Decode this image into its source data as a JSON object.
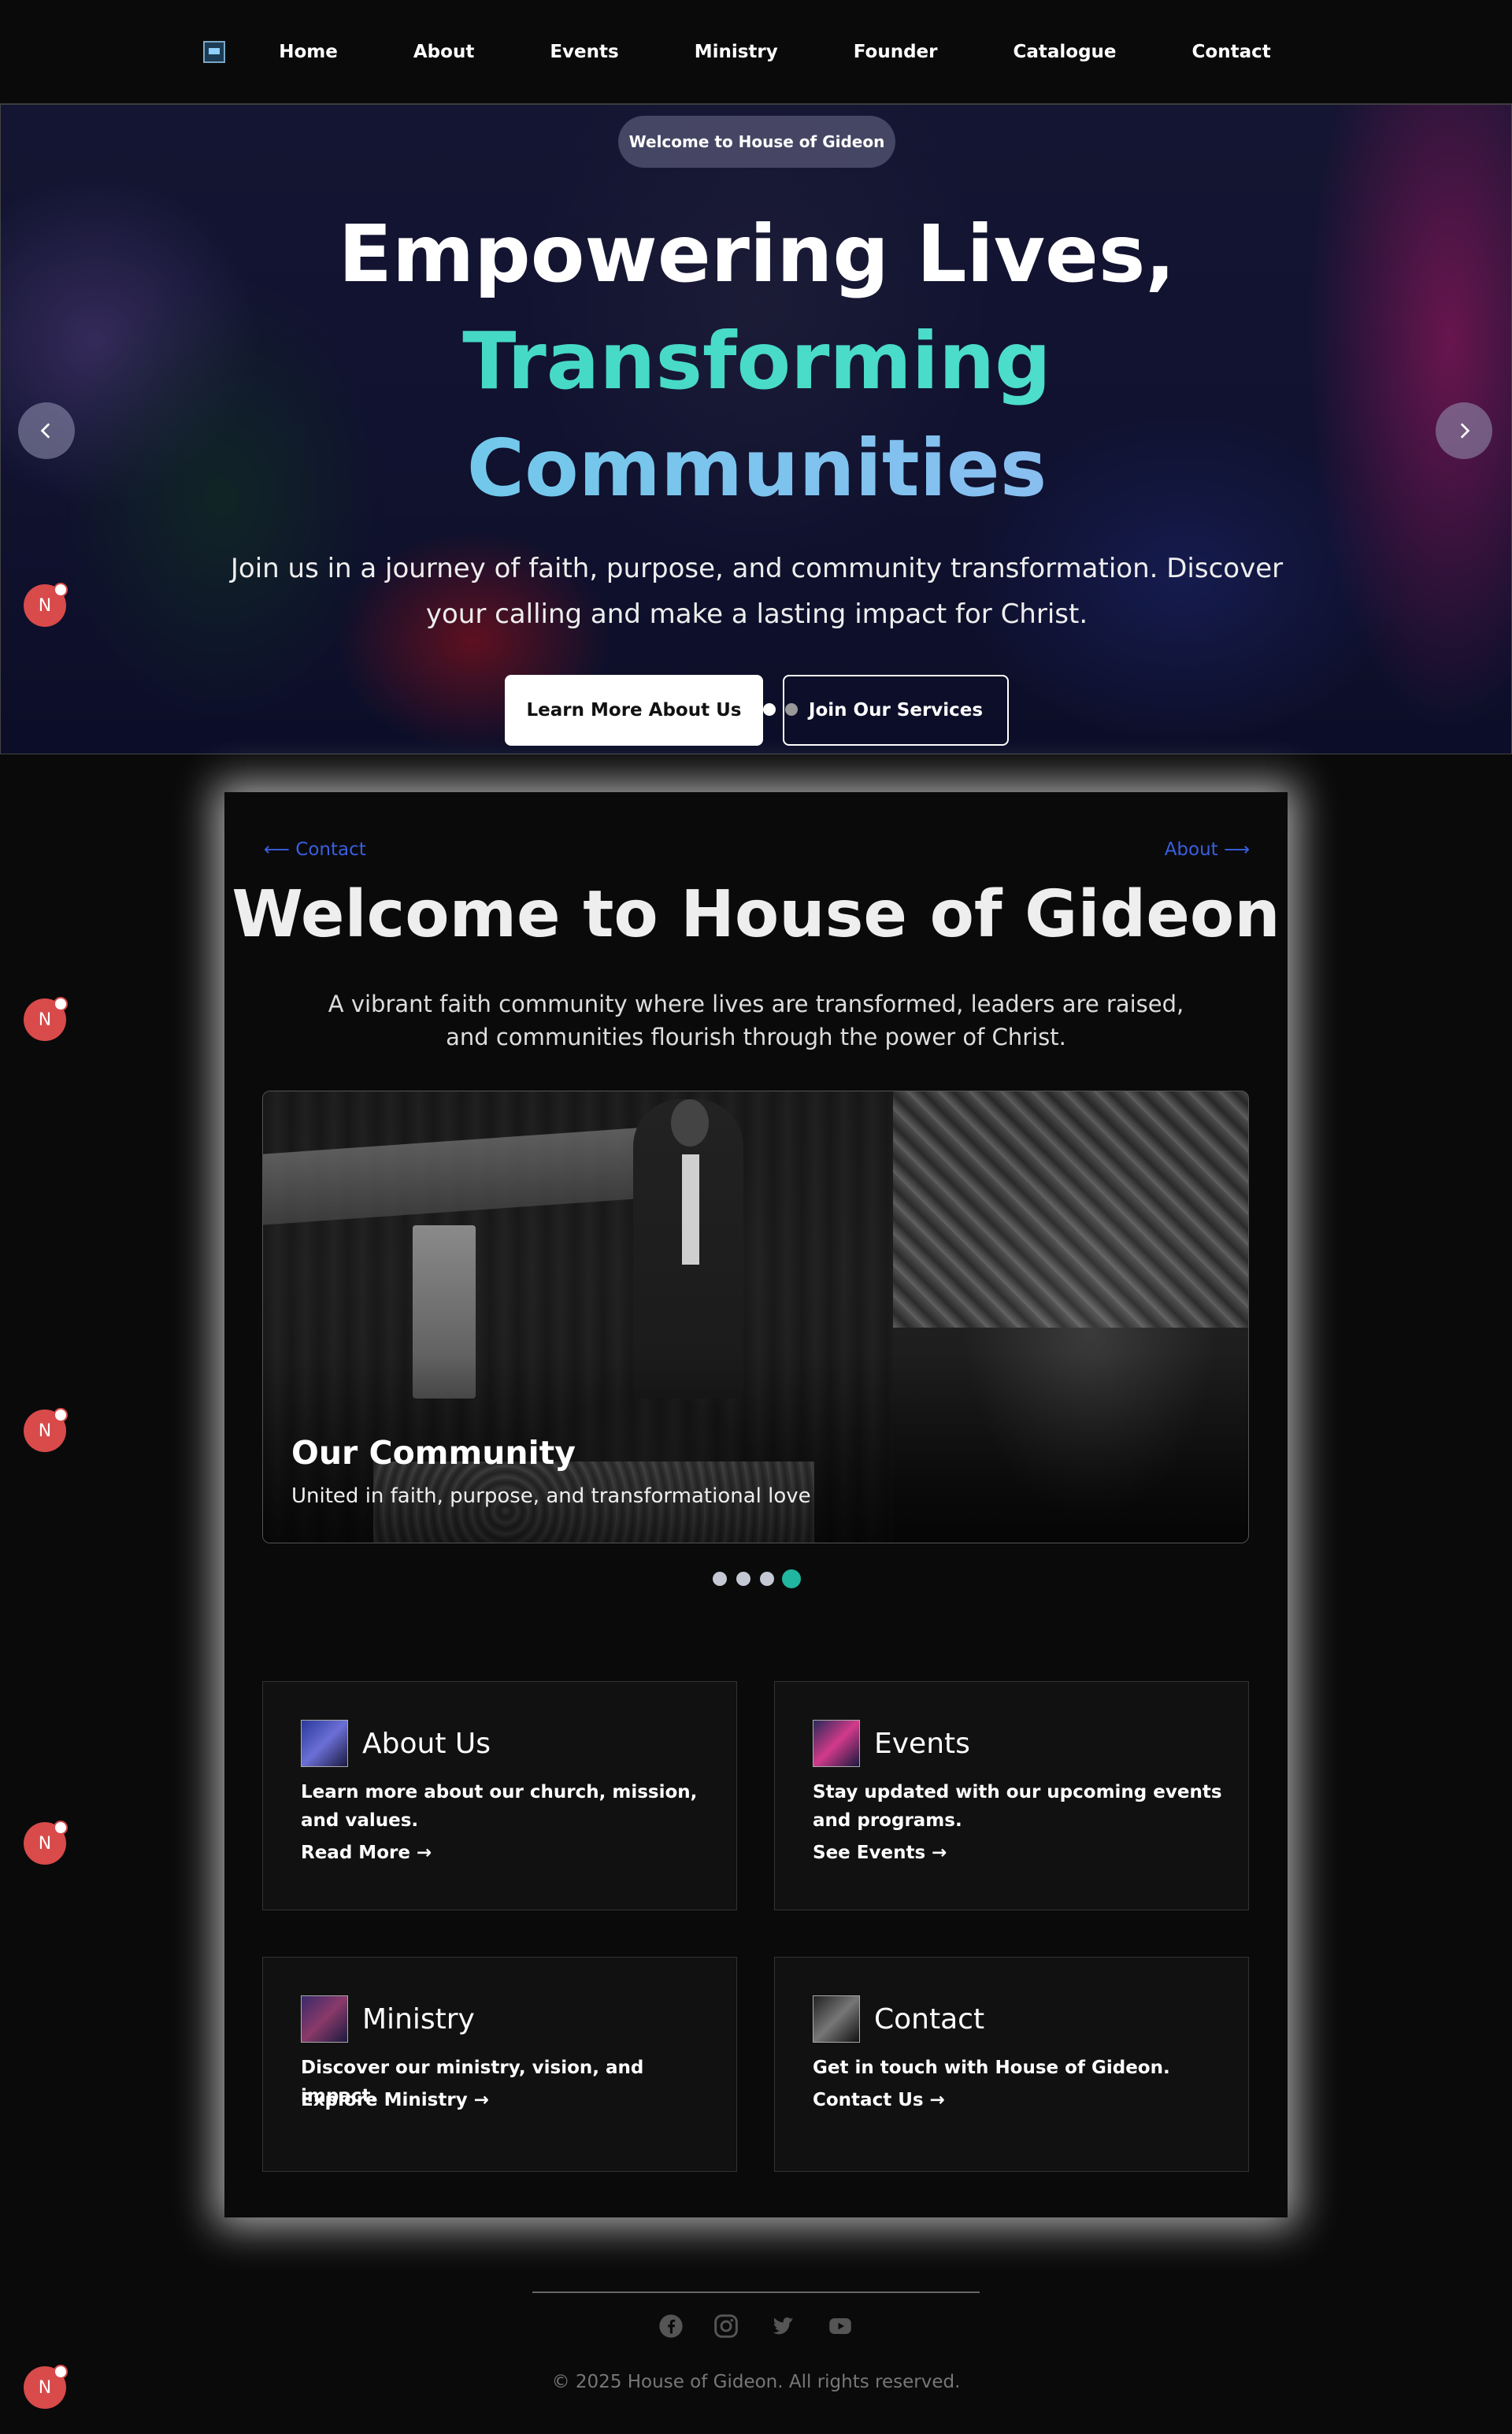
{
  "nav": {
    "logo_icon": "house-logo",
    "links": [
      "Home",
      "About",
      "Events",
      "Ministry",
      "Founder",
      "Catalogue",
      "Contact"
    ]
  },
  "hero": {
    "badge": "Welcome to House of Gideon",
    "title_line1": "Empowering Lives,",
    "title_line2": "Transforming",
    "title_line3": "Communities",
    "subtitle": "Join us in a journey of faith, purpose, and community transformation. Discover your calling and make a lasting impact for Christ.",
    "primary_button": "Learn More About Us",
    "secondary_button": "Join Our Services",
    "prev_icon": "chevron-left-icon",
    "next_icon": "chevron-right-icon",
    "gradient_colors": [
      "#3fd6c0",
      "#9bb7f5"
    ]
  },
  "floating_badge_letter": "N",
  "main": {
    "prev_link": "Contact",
    "next_link": "About",
    "title": "Welcome to House of Gideon",
    "subtitle": "A vibrant faith community where lives are transformed, leaders are raised, and communities flourish through the power of Christ.",
    "slide": {
      "title": "Our Community",
      "caption": "United in faith, purpose, and transformational love"
    },
    "slide_count": 4,
    "active_slide": 4,
    "cards": [
      {
        "title": "About Us",
        "description": "Learn more about our church, mission, and values.",
        "link": "Read More →"
      },
      {
        "title": "Events",
        "description": "Stay updated with our upcoming events and programs.",
        "link": "See Events →"
      },
      {
        "title": "Ministry",
        "description": "Discover our ministry, vision, and impact.",
        "link": "Explore Ministry →"
      },
      {
        "title": "Contact",
        "description": "Get in touch with House of Gideon.",
        "link": "Contact Us →"
      }
    ]
  },
  "footer": {
    "social_icons": [
      "facebook-icon",
      "instagram-icon",
      "twitter-icon",
      "youtube-icon"
    ],
    "copyright": "© 2025 House of Gideon. All rights reserved."
  },
  "colors": {
    "accent_link": "#3a5fe0",
    "active_dot": "#20b6a0",
    "badge_red": "#d94a4a"
  }
}
